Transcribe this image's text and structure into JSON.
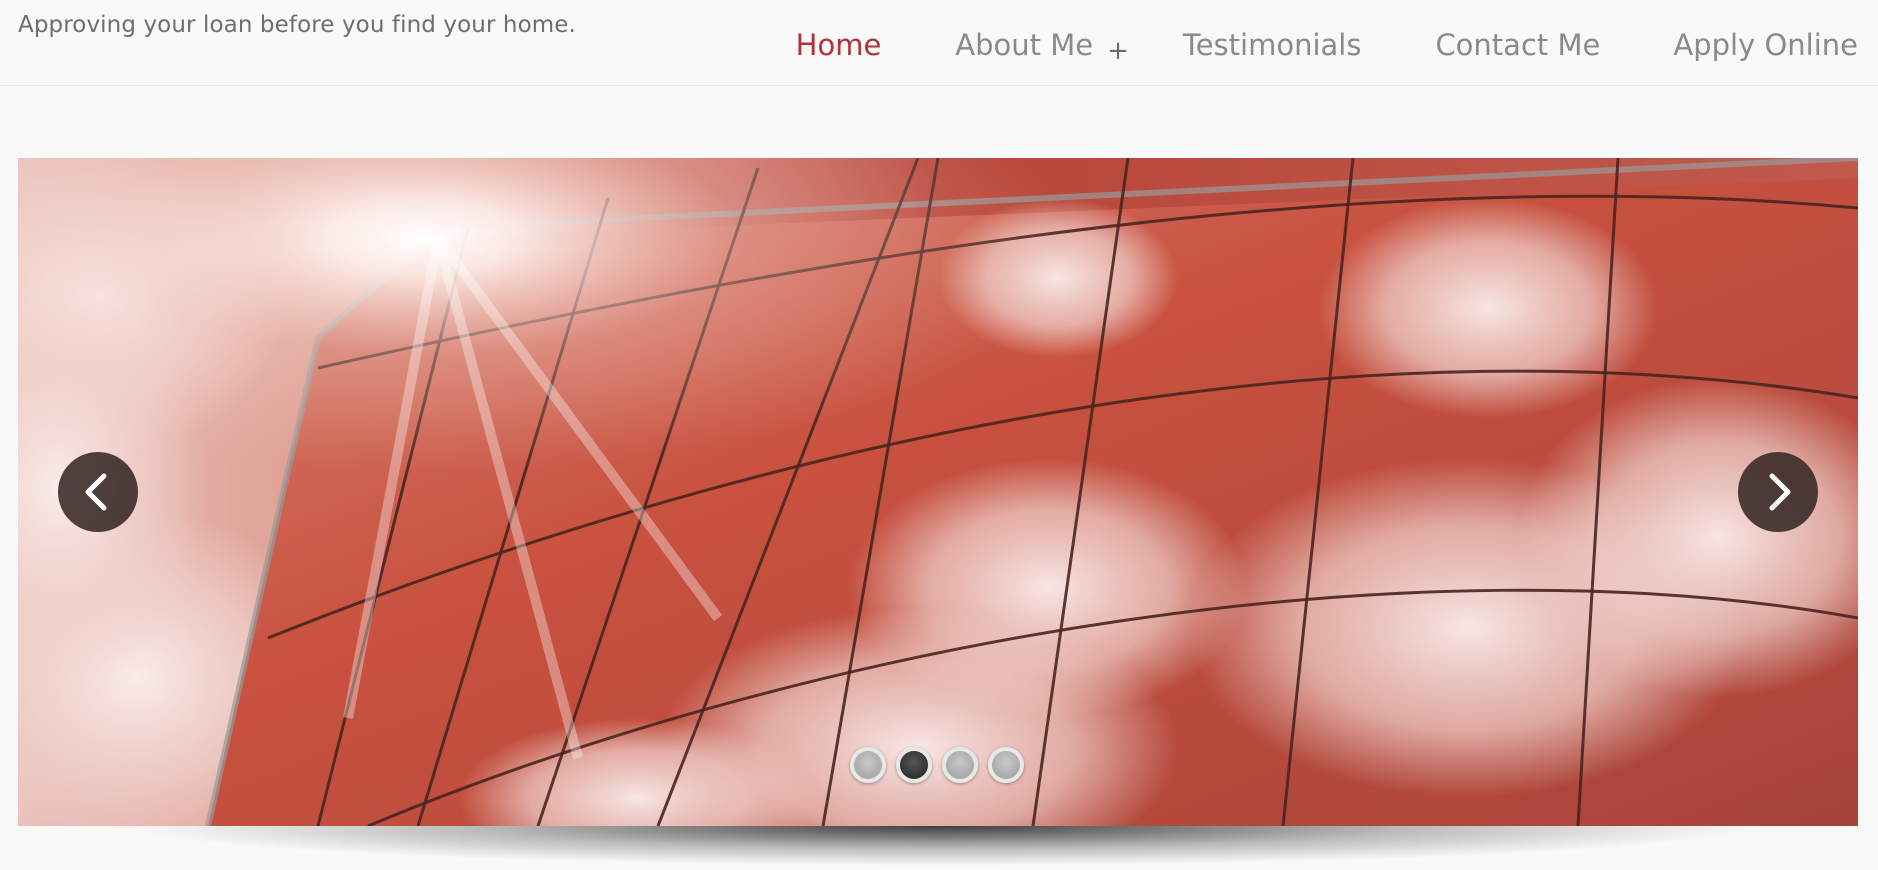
{
  "header": {
    "tagline": "Approving your loan before you find your home.",
    "nav": [
      {
        "label": "Home",
        "active": true
      },
      {
        "label": "About Me",
        "has_submenu": true
      },
      {
        "label": "Testimonials"
      },
      {
        "label": "Contact Me"
      },
      {
        "label": "Apply Online"
      }
    ],
    "submenu_symbol": "+"
  },
  "slider": {
    "total_slides": 4,
    "active_slide": 2,
    "prev_icon": "chevron-left-icon",
    "next_icon": "chevron-right-icon"
  },
  "colors": {
    "nav_active": "#b0323b",
    "nav_default": "#8a8a8a",
    "tagline": "#6e6e6e"
  }
}
